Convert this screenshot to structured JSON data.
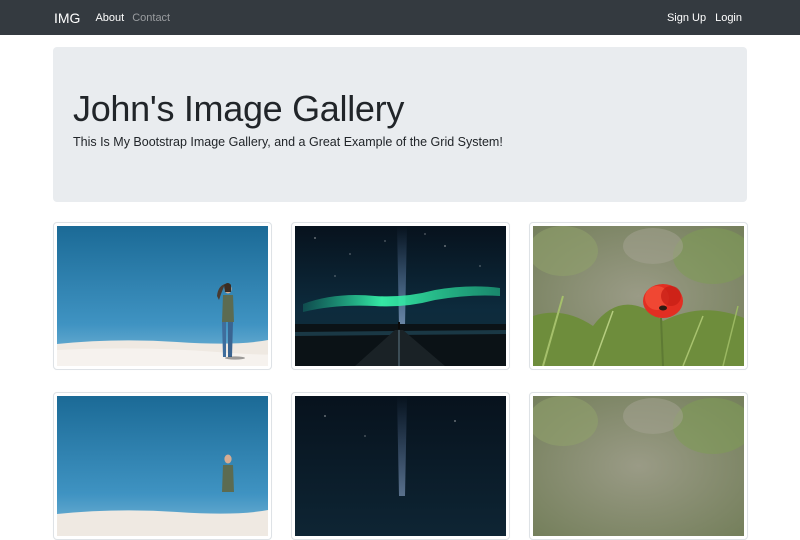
{
  "navbar": {
    "brand": "IMG",
    "links": [
      {
        "label": "About"
      },
      {
        "label": "Contact"
      }
    ],
    "right_links": [
      {
        "label": "Sign Up"
      },
      {
        "label": "Login"
      }
    ],
    "background": "#343a40"
  },
  "jumbotron": {
    "title": "John's Image Gallery",
    "subtitle": "This Is My Bootstrap Image Gallery, and a Great Example of the Grid System!",
    "background": "#e9ecef"
  },
  "gallery": {
    "images": [
      {
        "subject": "woman-standing-on-white-sand-dunes"
      },
      {
        "subject": "aurora-over-night-road"
      },
      {
        "subject": "red-poppy-in-grass"
      },
      {
        "subject": "woman-standing-on-white-sand-dunes"
      },
      {
        "subject": "aurora-over-night-road"
      },
      {
        "subject": "red-poppy-in-grass"
      }
    ]
  }
}
